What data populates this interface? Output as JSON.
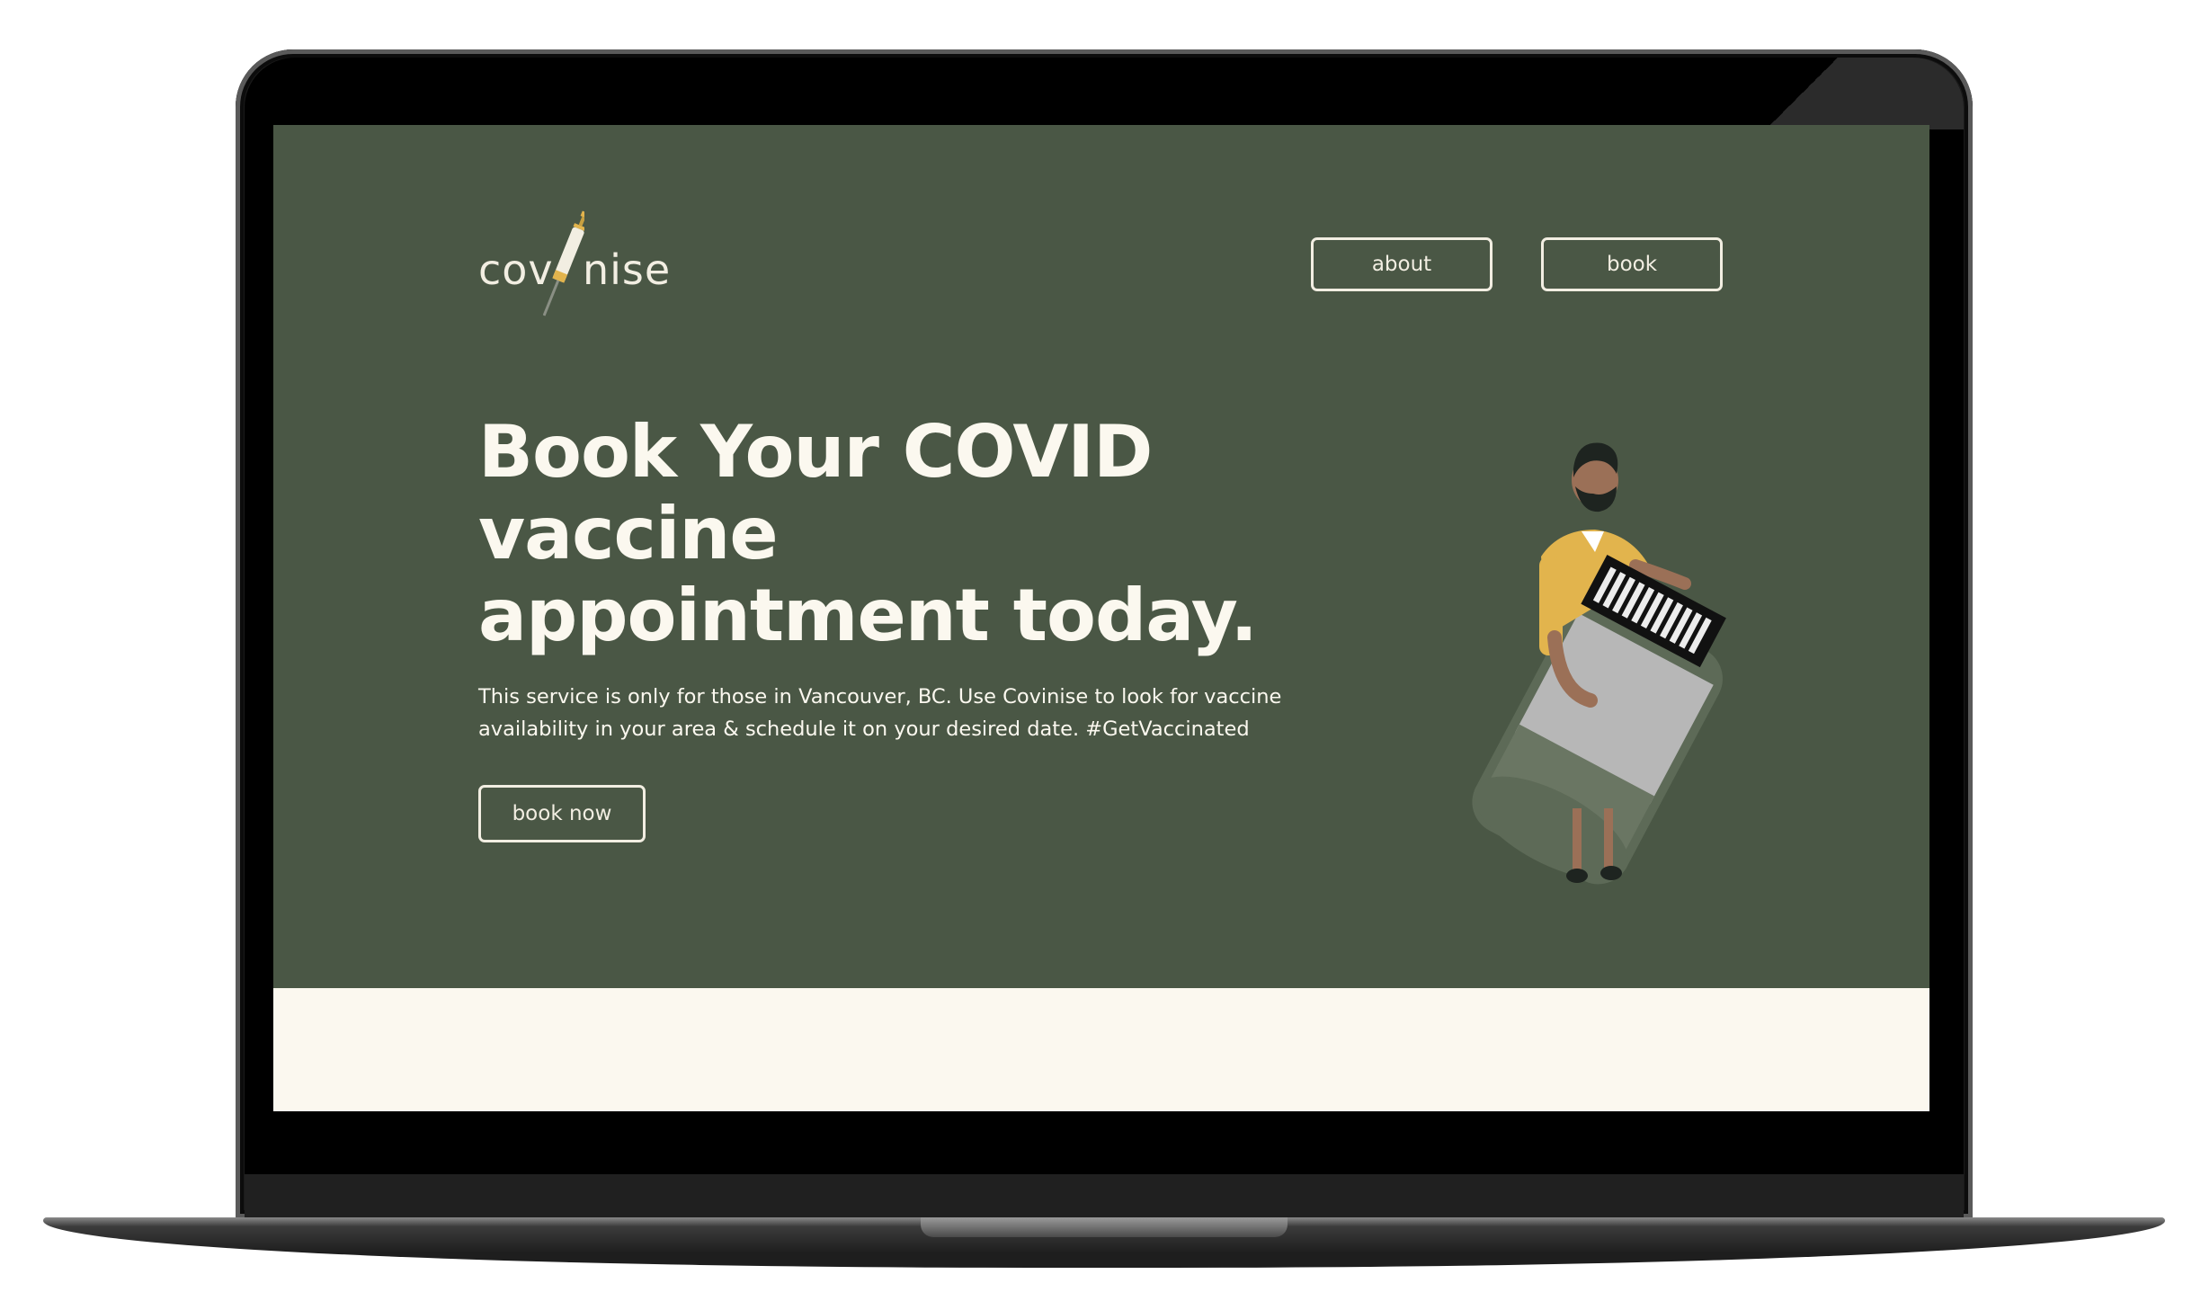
{
  "theme": {
    "hero_bg": "#4a5745",
    "cream": "#fbf8ef",
    "accent_yellow": "#e2b44d"
  },
  "logo": {
    "left": "cov",
    "right": "nise",
    "icon": "syringe-icon"
  },
  "nav": {
    "about": "about",
    "book": "book"
  },
  "hero": {
    "title": "Book Your COVID vaccine appointment today.",
    "description": "This service is only for those in Vancouver, BC. Use Covinise to look for vaccine availability in your area & schedule it on your desired date. #GetVaccinated",
    "cta": "book now"
  },
  "illustration": {
    "icon": "man-holding-vaccine-vial-illustration"
  }
}
